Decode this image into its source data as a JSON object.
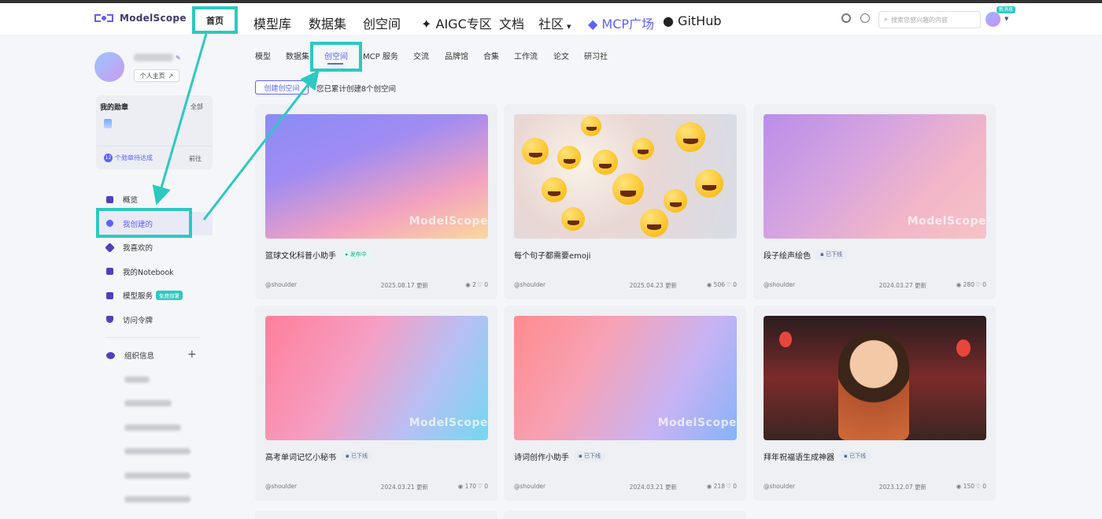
{
  "header": {
    "logo_text": "ModelScope",
    "nav": [
      "首页",
      "模型库",
      "数据集",
      "创空间",
      "AIGC专区",
      "文档",
      "社区",
      "MCP广场",
      "GitHub"
    ],
    "search_placeholder": "搜索您感兴趣的内容",
    "badge_new": "新消息"
  },
  "profile": {
    "home_label": "个人主页"
  },
  "medals": {
    "title": "我的勋章",
    "all_label": "全部",
    "count": "12",
    "pending_label": "个勋章待达成",
    "go_label": "前往"
  },
  "sidebar": {
    "items": [
      "概览",
      "我创建的",
      "我喜欢的",
      "我的Notebook",
      "模型服务",
      "访问令牌"
    ],
    "free_badge": "免费部署",
    "org_label": "组织信息"
  },
  "subtabs": [
    "模型",
    "数据集",
    "创空间",
    "MCP 服务",
    "交流",
    "品牌馆",
    "合集",
    "工作流",
    "论文",
    "研习社"
  ],
  "create_button": "创建创空间",
  "created_summary": "您已累计创建8个创空间",
  "cards": [
    {
      "title": "篮球文化科普小助手",
      "status": "发布中",
      "author": "@shoulder",
      "date": "2025.08.17 更新",
      "views": "2",
      "likes": "0",
      "image": "gradient"
    },
    {
      "title": "每个句子都需要emoji",
      "status": "",
      "author": "@shoulder",
      "date": "2025.04.23 更新",
      "views": "506",
      "likes": "0",
      "image": "emoji"
    },
    {
      "title": "段子绘声绘色",
      "status": "已下线",
      "author": "@shoulder",
      "date": "2024.03.27 更新",
      "views": "280",
      "likes": "0",
      "image": "gradient"
    },
    {
      "title": "高考单词记忆小秘书",
      "status": "已下线",
      "author": "@shoulder",
      "date": "2024.03.21 更新",
      "views": "170",
      "likes": "0",
      "image": "gradient"
    },
    {
      "title": "诗词创作小助手",
      "status": "已下线",
      "author": "@shoulder",
      "date": "2024.03.21 更新",
      "views": "218",
      "likes": "0",
      "image": "gradient"
    },
    {
      "title": "拜年祝福语生成神器",
      "status": "已下线",
      "author": "@shoulder",
      "date": "2023.12.07 更新",
      "views": "150",
      "likes": "0",
      "image": "photo"
    }
  ],
  "watermark": "ModelScope",
  "colors": {
    "accent": "#5b61ff",
    "highlight": "#2cc9c0"
  }
}
